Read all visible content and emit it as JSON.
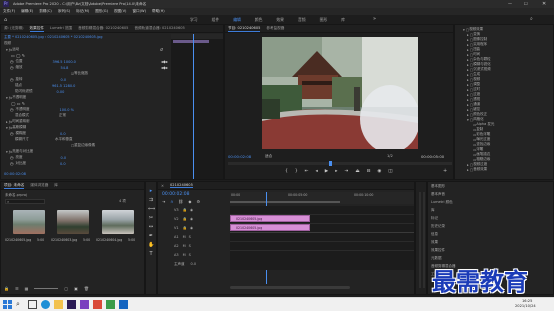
{
  "app": {
    "title": "Adobe Premiere Pro 2020 - C:\\用户\\Bz\\文档\\Adobe\\Premiere Pro\\14.0\\未命名",
    "menu": [
      "文件(F)",
      "编辑(E)",
      "剪辑(C)",
      "序列(S)",
      "标记(M)",
      "图形(G)",
      "视图(V)",
      "窗口(W)",
      "帮助(H)"
    ],
    "workspaces": [
      "学习",
      "组件",
      "编辑",
      "颜色",
      "效果",
      "音频",
      "图形",
      "库"
    ]
  },
  "effect_controls": {
    "tabs": [
      "源: (无剪辑)",
      "效果控件",
      "Lumetri 范围",
      "音频剪辑混合器: 0210240605",
      "音频轨道混合器: 0210240605"
    ],
    "clip_path": "主要 * 0210240605.jpg  ›  0210240605 * 0210240605.jpg",
    "rows": [
      {
        "label": "视频",
        "value": ""
      },
      {
        "label": "运动",
        "value": ""
      },
      {
        "label": "位置",
        "value": "396.5  1000.0"
      },
      {
        "label": "缩放",
        "value": "54.8"
      },
      {
        "label": "等比缩放",
        "value": ""
      },
      {
        "label": "旋转",
        "value": "0.0"
      },
      {
        "label": "锚点",
        "value": "961.5  1280.0"
      },
      {
        "label": "防闪烁滤镜",
        "value": "0.00"
      },
      {
        "label": "不透明度",
        "value": ""
      },
      {
        "label": "不透明度",
        "value": "100.0 %"
      },
      {
        "label": "混合模式",
        "value": "正常"
      },
      {
        "label": "时间重映射",
        "value": ""
      },
      {
        "label": "高斯模糊",
        "value": ""
      },
      {
        "label": "模糊度",
        "value": "0.0"
      },
      {
        "label": "模糊尺寸",
        "value": "水平和垂直"
      },
      {
        "label": "重复边缘像素",
        "value": ""
      },
      {
        "label": "亮度与对比度",
        "value": ""
      },
      {
        "label": "亮度",
        "value": "0.0"
      },
      {
        "label": "对比度",
        "value": "0.0"
      }
    ],
    "motion_checkbox_labels": [
      "运动",
      "均匀缩放",
      "已启用"
    ],
    "timecode": "00:00:02:08"
  },
  "program_monitor": {
    "tabs": [
      "节目: 0210240605",
      "参考监视器"
    ],
    "current_time": "00:00:02:08",
    "fit": "适合",
    "quality": "1/2",
    "duration": "00:00:05:00"
  },
  "effects_panel": {
    "items": [
      "视频效果",
      "变换",
      "图像控制",
      "实用程序",
      "扭曲",
      "时间",
      "杂色与颗粒",
      "模糊与锐化",
      "沉浸式视频",
      "生成",
      "视频",
      "调整",
      "过时",
      "过渡",
      "透视",
      "通道",
      "键控",
      "颜色校正",
      "风格化",
      "Alpha 发光",
      "复制",
      "彩色浮雕",
      "曝光过度",
      "查找边缘",
      "浮雕",
      "画笔描边",
      "粗糙边缘",
      "纹理",
      "色调分离",
      "闪光灯",
      "马赛克",
      "视频过渡",
      "音频效果"
    ],
    "sub_items": [
      "基本图形",
      "基本声音",
      "Lumetri 颜色",
      "库",
      "标记",
      "历史记录",
      "信息"
    ]
  },
  "project_panel": {
    "tabs": [
      "项目: 未命名",
      "媒体浏览器",
      "库"
    ],
    "project_name": "未命名.prproj",
    "item_count": "4 项",
    "clips": [
      {
        "name": "0210240605.jpg",
        "duration": "5:00"
      },
      {
        "name": "0210240603.jpg",
        "duration": "5:00"
      },
      {
        "name": "0210240604.jpg",
        "duration": "5:00"
      }
    ]
  },
  "timeline": {
    "tab": "0210240605",
    "timecode": "00:00:02:08",
    "ruler_marks": [
      "00:00",
      "00:00:05:00",
      "00:00:10:00"
    ],
    "tracks": [
      "V3",
      "V2",
      "V1",
      "A1",
      "A2",
      "A3",
      "主声道"
    ],
    "master_value": "0.0",
    "clips": [
      {
        "track": "V2",
        "name": "0210240605.jpg"
      },
      {
        "track": "V1",
        "name": "0210240605.jpg"
      }
    ]
  },
  "right_lower_panel": {
    "items": [
      "基本图形",
      "基本声音",
      "Lumetri 颜色",
      "库",
      "标记",
      "历史记录",
      "信息",
      "效果",
      "效果控件",
      "元数据",
      "音频剪辑混合器",
      "工作区"
    ]
  },
  "taskbar": {
    "time": "16:25",
    "date": "2021/10/24"
  },
  "watermark": {
    "text": "最需教育"
  },
  "colors": {
    "accent_blue": "#3d7bd8",
    "clip_pink": "#d78fd6",
    "keyframe_track": "#1a1a1a",
    "playhead": "#4a8ff0"
  }
}
